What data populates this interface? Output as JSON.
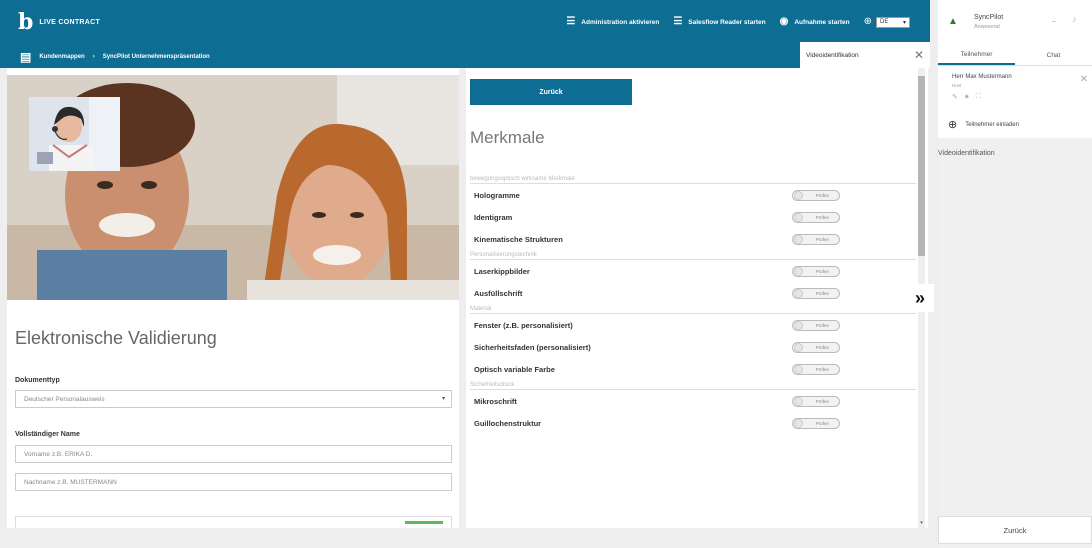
{
  "header": {
    "logo_mark": "b",
    "logo_text": "LIVE CONTRACT",
    "nav": [
      {
        "label": "Administration aktivieren",
        "icon": "list-icon"
      },
      {
        "label": "Salesflow Reader starten",
        "icon": "list-icon"
      },
      {
        "label": "Aufnahme starten",
        "icon": "record-icon"
      }
    ],
    "language": "DE",
    "breadcrumb": [
      "Kundenmappen",
      "SyncPilot Unternehmenspräsentation"
    ],
    "video_tab": "Videoidentifikation",
    "brand_color": "#0e6d93"
  },
  "left": {
    "title": "Elektronische Validierung",
    "doc_type_label": "Dokumenttyp",
    "doc_type_value": "Deutscher Personalausweis",
    "name_label": "Vollständiger Name",
    "firstname_placeholder": "Vorname z.B. ERIKA D.",
    "lastname_placeholder": "Nachname z.B. MUSTERMANN"
  },
  "middle": {
    "back_label": "Zurück",
    "title": "Merkmale",
    "toggle_label": "Prüfen",
    "sections": [
      {
        "title": "bewegungsoptisch wirksame Merkmale",
        "items": [
          "Hologramme",
          "Identigram",
          "Kinematische Strukturen"
        ]
      },
      {
        "title": "Personalisierungstechnik",
        "items": [
          "Laserkippbilder",
          "Ausfüllschrift"
        ]
      },
      {
        "title": "Material",
        "items": [
          "Fenster (z.B. personalisiert)",
          "Sicherheitsfaden (personalisiert)",
          "Optisch variable Farbe"
        ]
      },
      {
        "title": "Sicherheitsdruck",
        "items": [
          "Mikroschrift",
          "Guillochenstruktur"
        ]
      }
    ]
  },
  "expand_glyph": "»",
  "right": {
    "user_name": "SyncPilot",
    "user_role": "Anwesend",
    "tabs": [
      "Teilnehmer",
      "Chat"
    ],
    "participant_name": "Herr Max Mustermann",
    "participant_role": "Host",
    "invite_label": "Teilnehmer einladen",
    "section_title": "Videoidentifikation",
    "back_label": "Zurück"
  }
}
